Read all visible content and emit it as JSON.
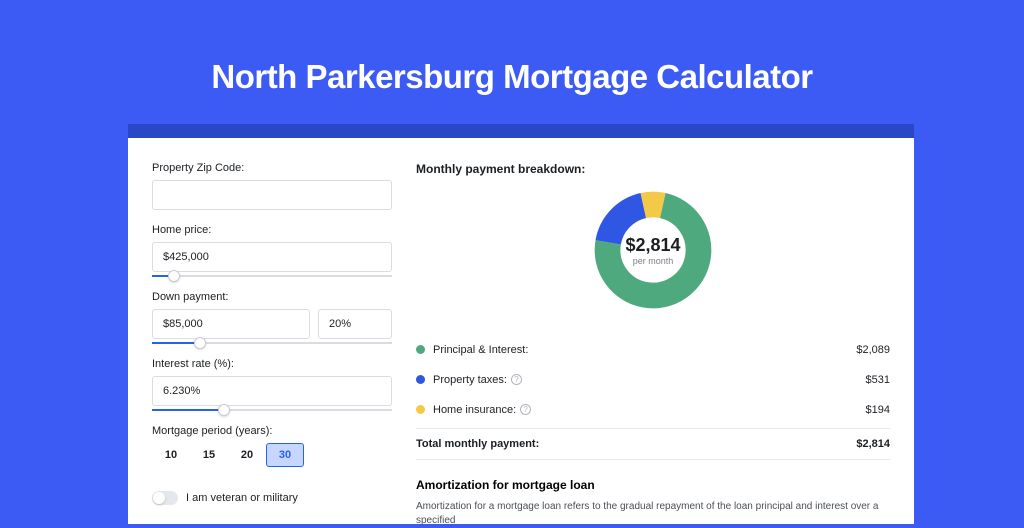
{
  "title": "North Parkersburg Mortgage Calculator",
  "form": {
    "zip_label": "Property Zip Code:",
    "zip_value": "",
    "home_price_label": "Home price:",
    "home_price_value": "$425,000",
    "home_price_slider_pct": 9,
    "down_payment_label": "Down payment:",
    "down_payment_value": "$85,000",
    "down_payment_pct": "20%",
    "down_payment_slider_pct": 20,
    "interest_label": "Interest rate (%):",
    "interest_value": "6.230%",
    "interest_slider_pct": 30,
    "period_label": "Mortgage period (years):",
    "periods": [
      "10",
      "15",
      "20",
      "30"
    ],
    "period_selected": "30",
    "veteran_label": "I am veteran or military"
  },
  "breakdown": {
    "heading": "Monthly payment breakdown:",
    "donut_amount": "$2,814",
    "donut_sub": "per month",
    "items": [
      {
        "label": "Principal & Interest:",
        "value": "$2,089",
        "color": "#4ea97f",
        "info": false
      },
      {
        "label": "Property taxes:",
        "value": "$531",
        "color": "#2f57e3",
        "info": true
      },
      {
        "label": "Home insurance:",
        "value": "$194",
        "color": "#f3c948",
        "info": true
      }
    ],
    "total_label": "Total monthly payment:",
    "total_value": "$2,814"
  },
  "amortization": {
    "heading": "Amortization for mortgage loan",
    "text": "Amortization for a mortgage loan refers to the gradual repayment of the loan principal and interest over a specified"
  },
  "chart_data": {
    "type": "pie",
    "title": "Monthly payment breakdown",
    "series": [
      {
        "name": "Principal & Interest",
        "value": 2089,
        "color": "#4ea97f"
      },
      {
        "name": "Property taxes",
        "value": 531,
        "color": "#2f57e3"
      },
      {
        "name": "Home insurance",
        "value": 194,
        "color": "#f3c948"
      }
    ],
    "total": 2814,
    "center_label": "$2,814 per month"
  }
}
